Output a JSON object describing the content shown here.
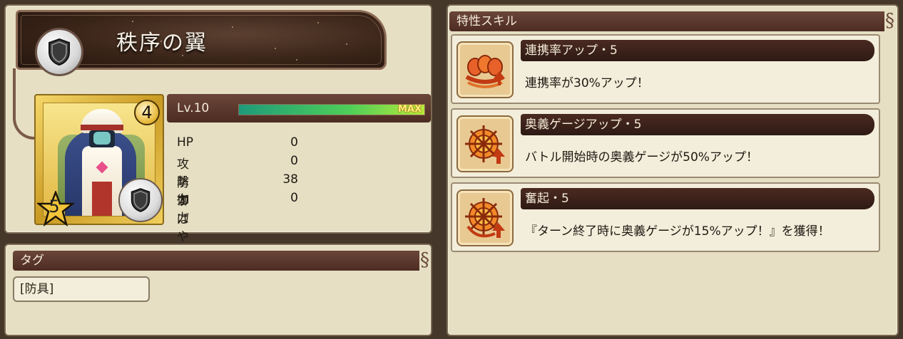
{
  "equipment": {
    "name": "秩序の翼",
    "type_icon": "shield-icon",
    "rarity": "4",
    "stars": "5",
    "level_label": "Lv.10",
    "level_fraction": 1.0,
    "max_label": "MAX",
    "stats": [
      {
        "name": "HP",
        "value": "0"
      },
      {
        "name": "攻撃力",
        "value": "0"
      },
      {
        "name": "防御力",
        "value": "38"
      },
      {
        "name": "すばやさ",
        "value": "0"
      }
    ]
  },
  "tags": {
    "header": "タグ",
    "items": [
      "[防具]"
    ]
  },
  "skills": {
    "header": "特性スキル",
    "items": [
      {
        "name": "連携率アップ・5",
        "desc": "連携率が30%アップ！",
        "icon": "chain-rate-icon"
      },
      {
        "name": "奥義ゲージアップ・5",
        "desc": "バトル開始時の奥義ゲージが50%アップ！",
        "icon": "gauge-up-icon"
      },
      {
        "name": "奮起・5",
        "desc": "『ターン終了時に奥義ゲージが15%アップ！』を獲得！",
        "icon": "rouse-icon"
      }
    ]
  },
  "colors": {
    "panel": "#e6dfc3",
    "bar": "#4d2c22",
    "background": "#45372a"
  }
}
